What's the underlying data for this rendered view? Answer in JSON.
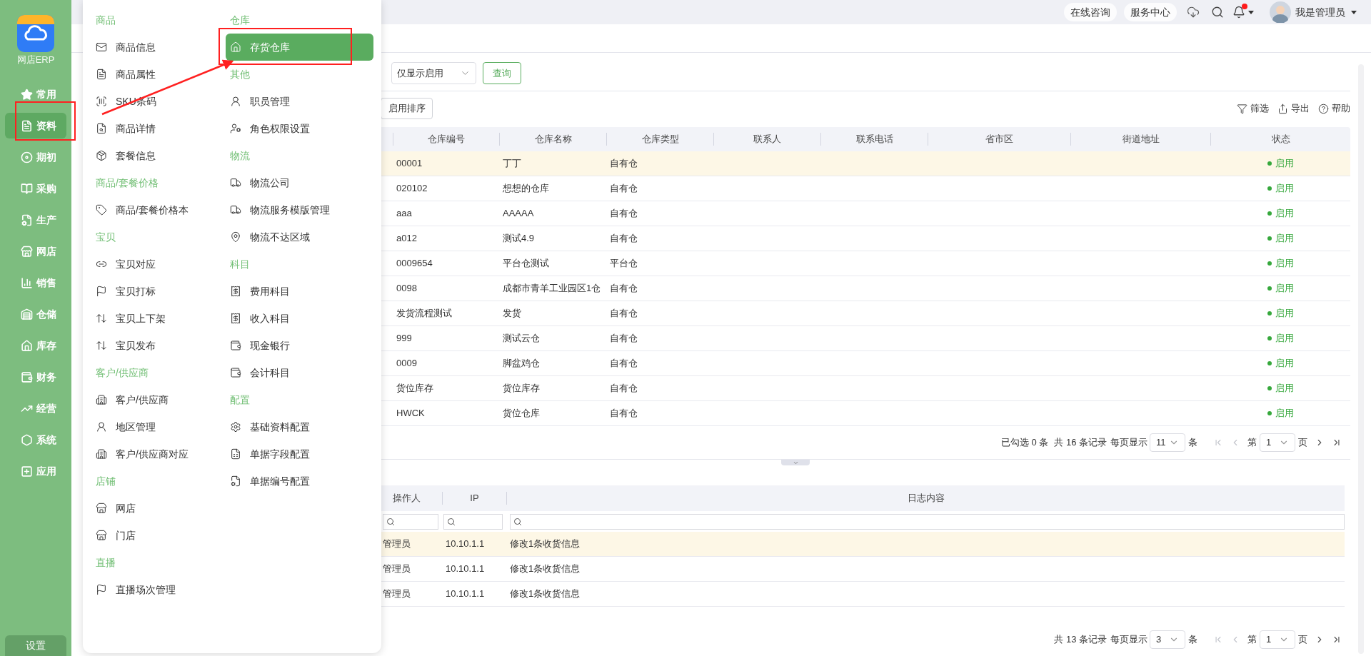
{
  "app": {
    "name": "网店ERP"
  },
  "sidebar": {
    "items": [
      {
        "label": "常用",
        "selected": false
      },
      {
        "label": "资料",
        "selected": true
      },
      {
        "label": "期初",
        "selected": false
      },
      {
        "label": "采购",
        "selected": false
      },
      {
        "label": "生产",
        "selected": false
      },
      {
        "label": "网店",
        "selected": false
      },
      {
        "label": "销售",
        "selected": false
      },
      {
        "label": "仓储",
        "selected": false
      },
      {
        "label": "库存",
        "selected": false
      },
      {
        "label": "财务",
        "selected": false
      },
      {
        "label": "经营",
        "selected": false
      },
      {
        "label": "系统",
        "selected": false
      },
      {
        "label": "应用",
        "selected": false
      }
    ],
    "settings": "设置"
  },
  "topbar": {
    "buttons": [
      "在线咨询",
      "服务中心"
    ],
    "notification": {
      "unread": true
    },
    "user": "我是管理员"
  },
  "menu": {
    "columns": [
      {
        "groups": [
          {
            "title": "商品",
            "items": [
              {
                "label": "商品信息",
                "selected": false
              },
              {
                "label": "商品属性",
                "selected": false
              },
              {
                "label": "SKU条码",
                "selected": false
              },
              {
                "label": "商品详情",
                "selected": false
              },
              {
                "label": "套餐信息",
                "selected": false
              }
            ]
          },
          {
            "title": "商品/套餐价格",
            "items": [
              {
                "label": "商品/套餐价格本",
                "selected": false
              }
            ]
          },
          {
            "title": "宝贝",
            "items": [
              {
                "label": "宝贝对应",
                "selected": false
              },
              {
                "label": "宝贝打标",
                "selected": false
              },
              {
                "label": "宝贝上下架",
                "selected": false
              },
              {
                "label": "宝贝发布",
                "selected": false
              }
            ]
          },
          {
            "title": "客户/供应商",
            "items": [
              {
                "label": "客户/供应商",
                "selected": false
              },
              {
                "label": "地区管理",
                "selected": false
              },
              {
                "label": "客户/供应商对应",
                "selected": false
              }
            ]
          },
          {
            "title": "店铺",
            "items": [
              {
                "label": "网店",
                "selected": false
              },
              {
                "label": "门店",
                "selected": false
              }
            ]
          },
          {
            "title": "直播",
            "items": [
              {
                "label": "直播场次管理",
                "selected": false
              }
            ]
          }
        ]
      },
      {
        "groups": [
          {
            "title": "仓库",
            "items": [
              {
                "label": "存货仓库",
                "selected": true
              }
            ]
          },
          {
            "title": "其他",
            "items": [
              {
                "label": "职员管理",
                "selected": false
              },
              {
                "label": "角色权限设置",
                "selected": false
              }
            ]
          },
          {
            "title": "物流",
            "items": [
              {
                "label": "物流公司",
                "selected": false
              },
              {
                "label": "物流服务模版管理",
                "selected": false
              },
              {
                "label": "物流不达区域",
                "selected": false
              }
            ]
          },
          {
            "title": "科目",
            "items": [
              {
                "label": "费用科目",
                "selected": false
              },
              {
                "label": "收入科目",
                "selected": false
              },
              {
                "label": "现金银行",
                "selected": false
              },
              {
                "label": "会计科目",
                "selected": false
              }
            ]
          },
          {
            "title": "配置",
            "items": [
              {
                "label": "基础资料配置",
                "selected": false
              },
              {
                "label": "单据字段配置",
                "selected": false
              },
              {
                "label": "单据编号配置",
                "selected": false
              }
            ]
          }
        ]
      }
    ]
  },
  "filters": {
    "status_select": "仅显示启用",
    "query_button": "查询"
  },
  "toolbar": {
    "sort_button": "启用排序",
    "actions": [
      "筛选",
      "导出",
      "帮助"
    ]
  },
  "table": {
    "columns": [
      "仓库编号",
      "仓库名称",
      "仓库类型",
      "联系人",
      "联系电话",
      "省市区",
      "街道地址",
      "状态"
    ],
    "rows": [
      {
        "selected": true,
        "cells": [
          "00001",
          "丁丁",
          "自有仓"
        ],
        "status": "启用"
      },
      {
        "selected": false,
        "cells": [
          "020102",
          "想想的仓库",
          "自有仓"
        ],
        "status": "启用"
      },
      {
        "selected": false,
        "cells": [
          "aaa",
          "AAAAA",
          "自有仓"
        ],
        "status": "启用"
      },
      {
        "selected": false,
        "cells": [
          "a012",
          "测试4.9",
          "自有仓"
        ],
        "status": "启用"
      },
      {
        "selected": false,
        "cells": [
          "0009654",
          "平台仓测试",
          "平台仓"
        ],
        "status": "启用"
      },
      {
        "selected": false,
        "cells": [
          "0098",
          "成都市青羊工业园区1仓",
          "自有仓"
        ],
        "status": "启用"
      },
      {
        "selected": false,
        "cells": [
          "发货流程测试",
          "发货",
          "自有仓"
        ],
        "status": "启用"
      },
      {
        "selected": false,
        "cells": [
          "999",
          "测试云仓",
          "自有仓"
        ],
        "status": "启用"
      },
      {
        "selected": false,
        "cells": [
          "0009",
          "脚盆鸡仓",
          "自有仓"
        ],
        "status": "启用"
      },
      {
        "selected": false,
        "cells": [
          "货位库存",
          "货位库存",
          "自有仓"
        ],
        "status": "启用"
      },
      {
        "selected": false,
        "cells": [
          "HWCK",
          "货位仓库",
          "自有仓"
        ],
        "status": "启用"
      }
    ],
    "pager": {
      "selection": "已勾选 0 条",
      "total": "共 16 条记录",
      "per_page_label": "每页显示",
      "per_page": "11",
      "per_page_unit": "条",
      "page_prefix": "第",
      "page": "1",
      "page_suffix": "页",
      "at_first_page": true
    }
  },
  "log": {
    "columns": [
      "操作人",
      "IP",
      "日志内容"
    ],
    "rows": [
      {
        "selected": true,
        "operator": "管理员",
        "ip": "10.10.1.1",
        "content": "修改1条收货信息"
      },
      {
        "selected": false,
        "operator": "管理员",
        "ip": "10.10.1.1",
        "content": "修改1条收货信息"
      },
      {
        "selected": false,
        "operator": "管理员",
        "ip": "10.10.1.1",
        "content": "修改1条收货信息"
      }
    ],
    "pager": {
      "total": "共 13 条记录",
      "per_page_label": "每页显示",
      "per_page": "3",
      "per_page_unit": "条",
      "page_prefix": "第",
      "page": "1",
      "page_suffix": "页",
      "at_first_page": true
    }
  }
}
